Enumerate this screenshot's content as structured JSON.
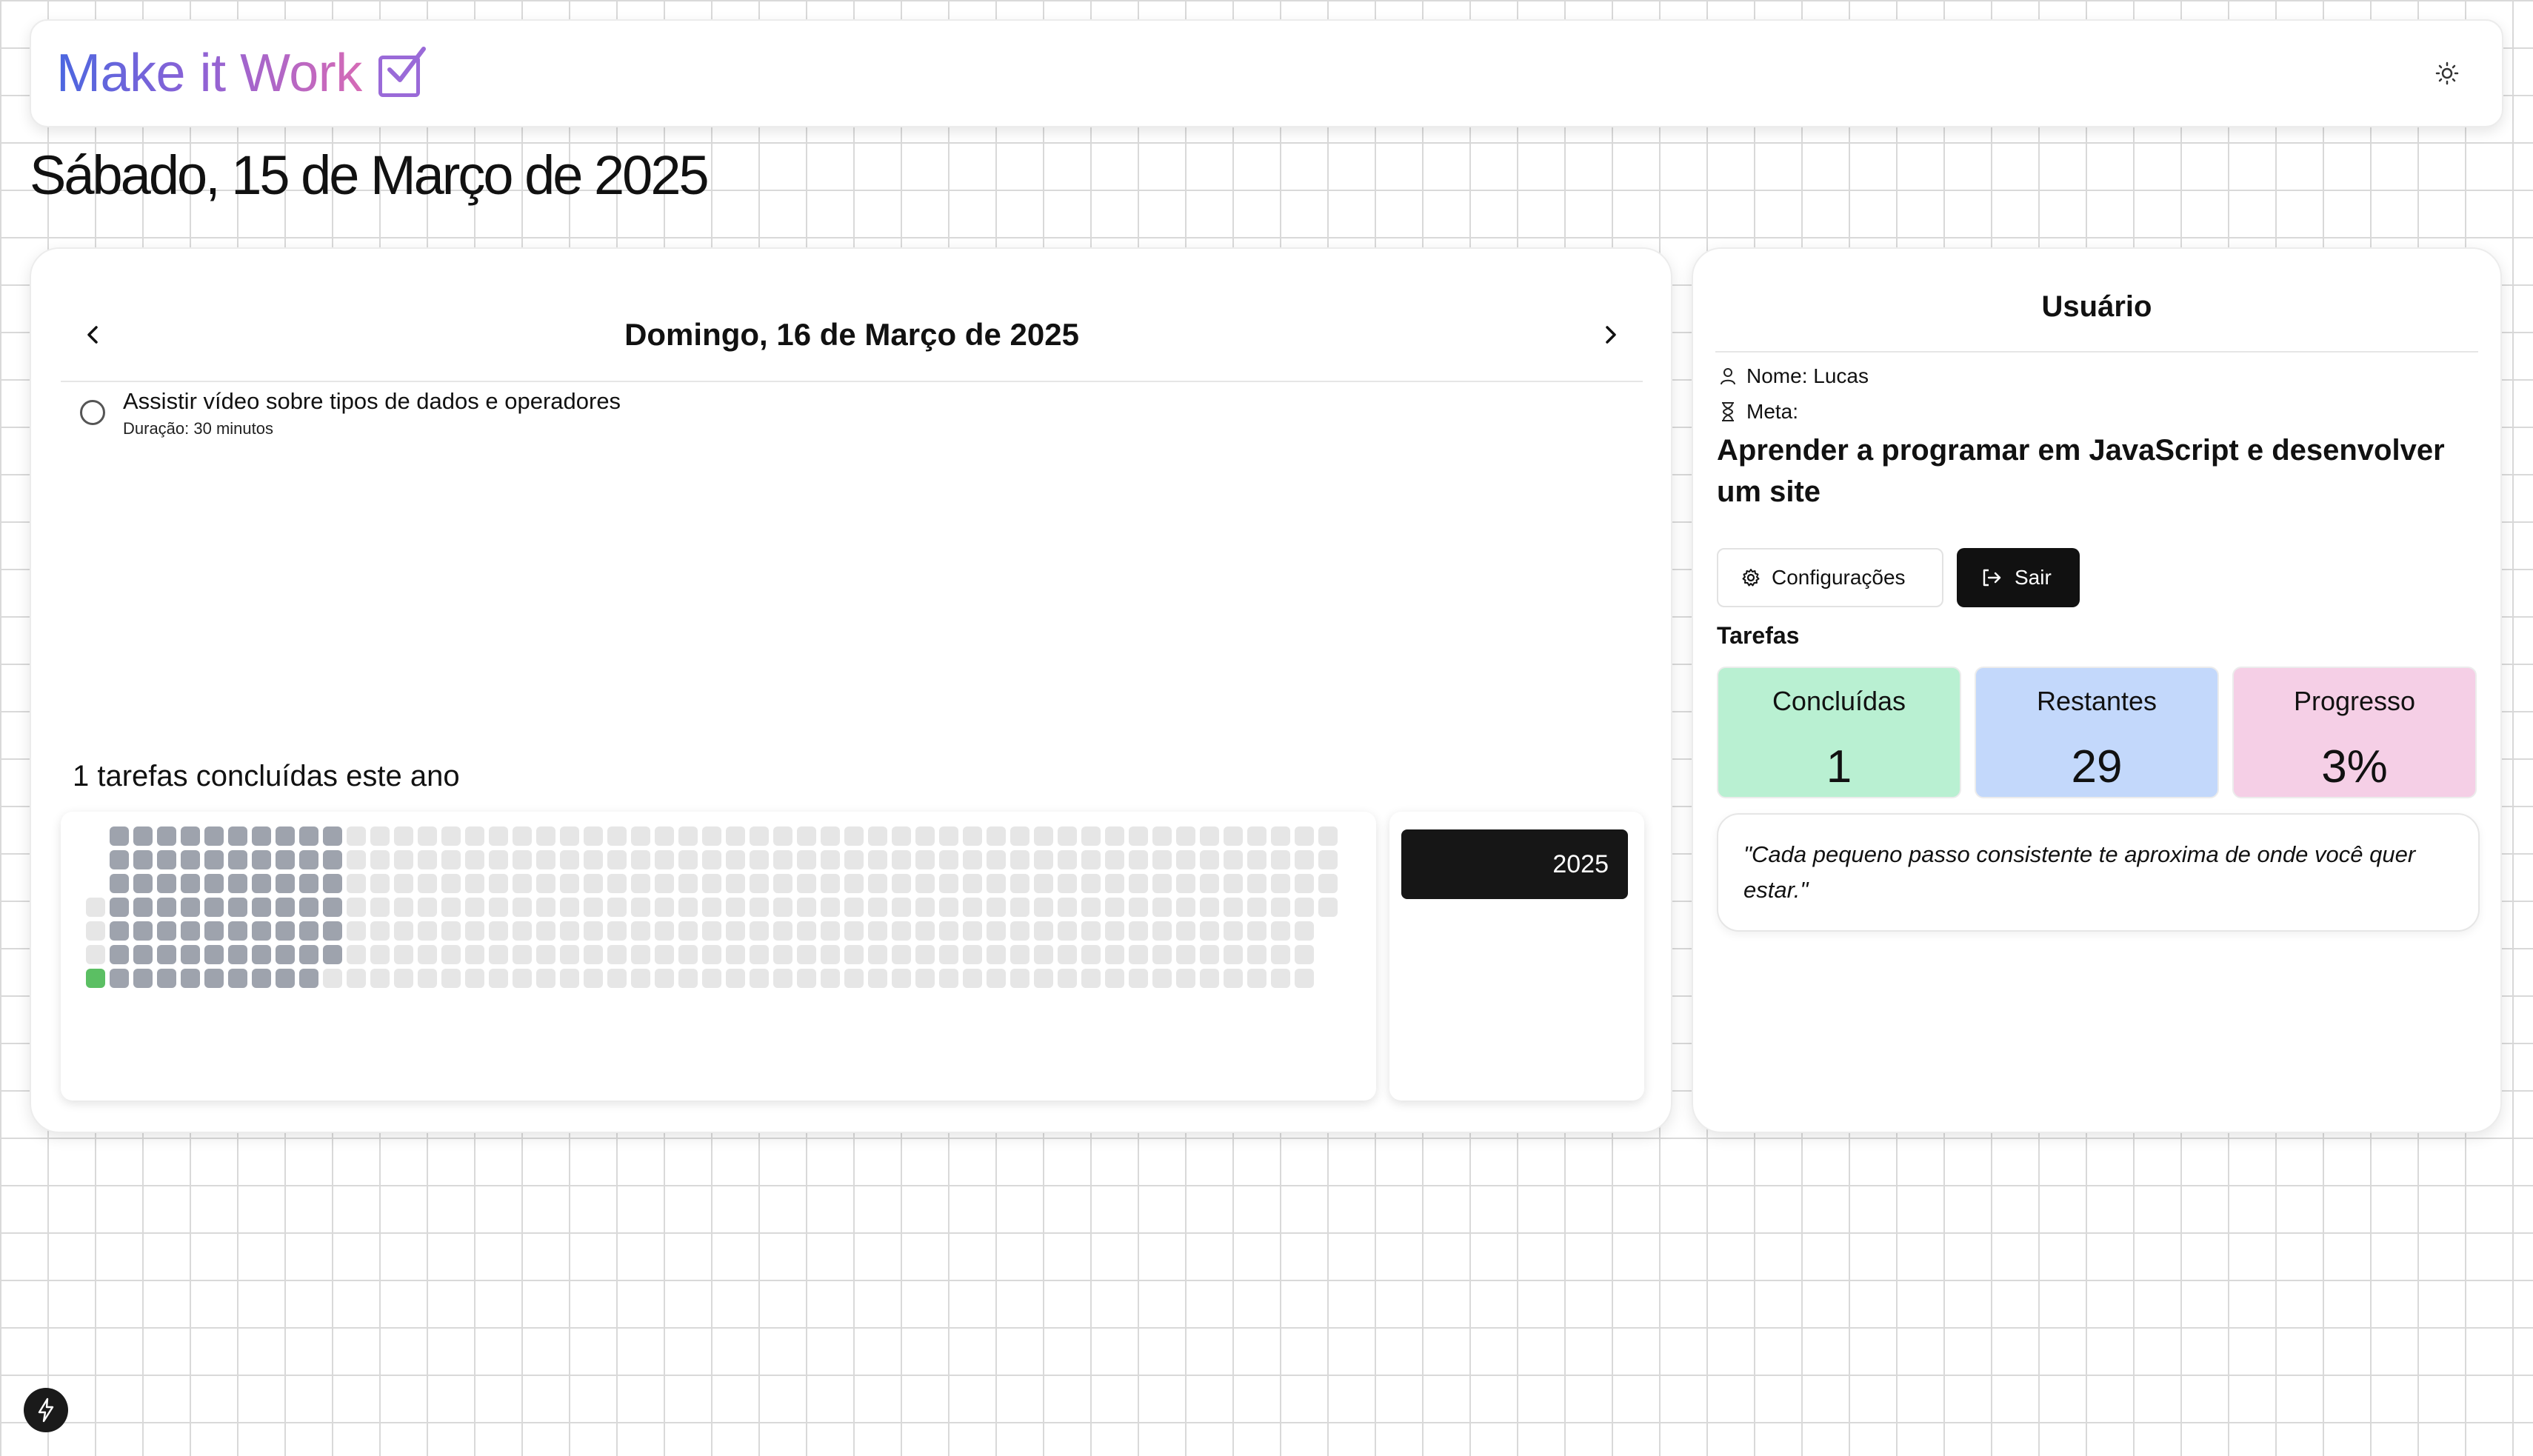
{
  "header": {
    "app_title": "Make it Work",
    "check_icon": "check-square-icon",
    "theme_icon": "sun-icon"
  },
  "date_heading": "Sábado, 15 de Março de 2025",
  "day_view": {
    "title": "Domingo, 16 de Março de 2025",
    "prev_icon": "chevron-left-icon",
    "next_icon": "chevron-right-icon",
    "tasks": [
      {
        "name": "Assistir vídeo sobre tipos de dados e operadores",
        "duration": "Duração: 30 minutos",
        "completed": false
      }
    ]
  },
  "year_summary": "1 tarefas concluídas este ano",
  "year_selector": {
    "selected": "2025"
  },
  "heatmap": {
    "weeks": 53,
    "days_per_week": 7,
    "completed_count": 1,
    "colors": {
      "empty": "#e6e6e6",
      "past": "#9ea3ad",
      "done": "#5bbf63"
    }
  },
  "user": {
    "title": "Usuário",
    "name_label": "Nome: Lucas",
    "goal_label": "Meta:",
    "goal": "Aprender a programar em JavaScript e desenvolver um site",
    "settings_button": "Configurações",
    "logout_button": "Sair",
    "tasks_label": "Tarefas",
    "stats": {
      "done_label": "Concluídas",
      "done_value": "1",
      "remaining_label": "Restantes",
      "remaining_value": "29",
      "progress_label": "Progresso",
      "progress_value": "3%"
    },
    "quote": "\"Cada pequeno passo consistente te aproxima de onde você quer estar.\""
  },
  "colors": {
    "accent_gradient_start": "#4b67e0",
    "accent_gradient_end": "#d66bb6",
    "done_bg": "#b9f0d2",
    "remaining_bg": "#c3d8fb",
    "progress_bg": "#f5cfe6"
  }
}
